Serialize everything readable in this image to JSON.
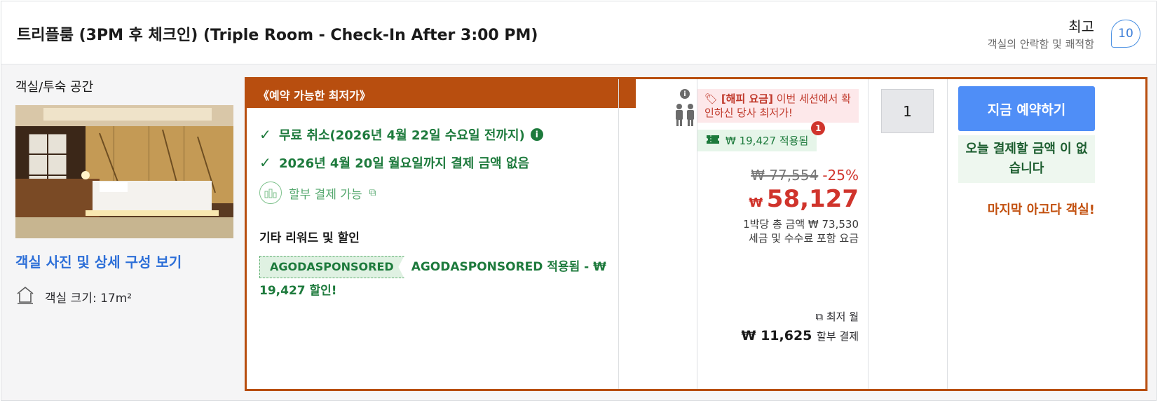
{
  "header": {
    "room_title": "트리플룸 (3PM 후 체크인) (Triple Room - Check-In After 3:00 PM)",
    "rating_word": "최고",
    "rating_sub": "객실의 안락함 및 쾌적함",
    "rating_score": "10"
  },
  "room": {
    "type_label": "객실/투숙 공간",
    "photos_link": "객실 사진 및 상세 구성 보기",
    "size_text": "객실 크기: 17m²"
  },
  "offer": {
    "banner": "《예약 가능한 최저가》",
    "benefits": [
      "무료 취소(2026년 4월 22일 수요일 전까지)",
      "2026년 4월 20일 월요일까지 결제 금액 없음"
    ],
    "installment": "할부 결제 가능",
    "rewards_title": "기타 리워드 및 할인",
    "promo_code": "AGODASPONSORED",
    "promo_text": "AGODASPONSORED 적용됨 - ₩ 19,427 할인!"
  },
  "price": {
    "happy_tag": "[해피 요금]",
    "happy_text": "이번 세션에서 확인하신 당사 최저가!",
    "coupon_text": "₩ 19,427 적용됨",
    "coupon_count": "1",
    "original": "₩ 77,554",
    "discount": "-25%",
    "currency": "₩",
    "final": "58,127",
    "total_line": "1박당 총 금액 ₩ 73,530",
    "tax_line": "세금 및 수수료 포함 요금",
    "monthly_label": "최저 월",
    "monthly_amount": "₩ 11,625",
    "monthly_suffix": "할부 결제"
  },
  "booking": {
    "quantity": "1",
    "book_button": "지금 예약하기",
    "pay_today": "오늘 결제할 금액 이 없습니다",
    "last_room": "마지막 아고다 객실!"
  },
  "colors": {
    "accent_orange": "#b84e0f",
    "green": "#1d7a3c",
    "price_red": "#d0342c",
    "button_blue": "#4f8ef7"
  }
}
